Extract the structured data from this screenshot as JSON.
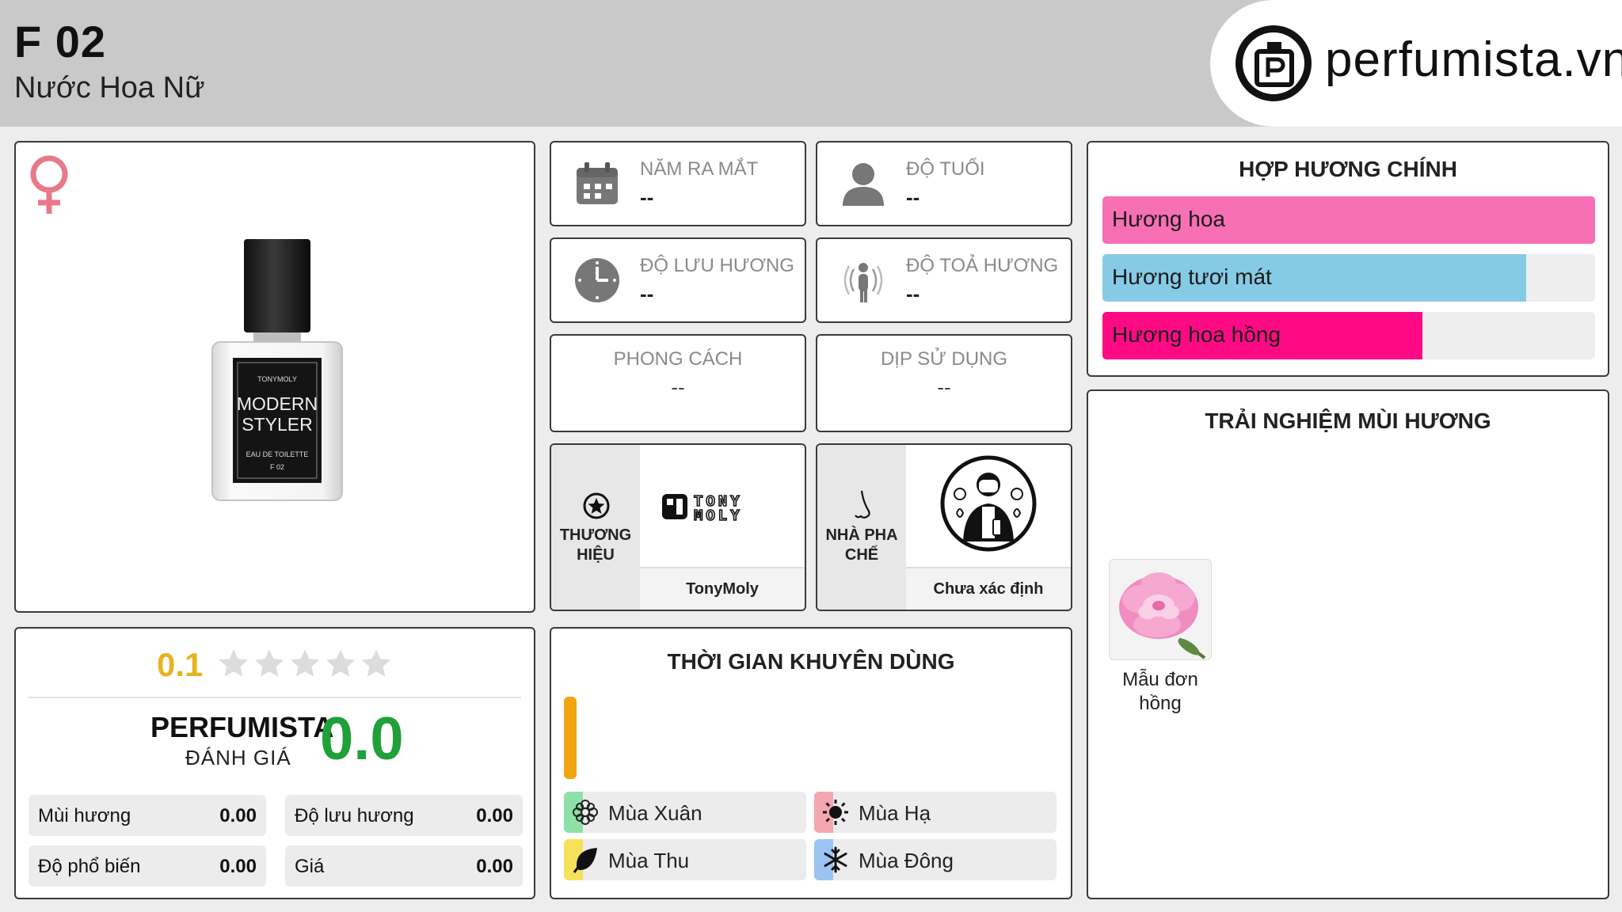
{
  "header": {
    "code": "F 02",
    "subtitle": "Nước Hoa Nữ",
    "logo_text": "perfumista.vn"
  },
  "product": {
    "gender_icon": "venus-icon",
    "bottle_label": {
      "brand": "TONYMOLY",
      "line1": "MODERN",
      "line2": "STYLER",
      "type": "EAU DE TOILETTE",
      "code": "F 02"
    }
  },
  "info": {
    "launch_year": {
      "label": "NĂM RA MẮT",
      "value": "--",
      "icon": "calendar-icon"
    },
    "age": {
      "label": "ĐỘ TUỔI",
      "value": "--",
      "icon": "person-icon"
    },
    "longevity": {
      "label": "ĐỘ LƯU HƯƠNG",
      "value": "--",
      "icon": "clock-icon"
    },
    "sillage": {
      "label": "ĐỘ TOẢ HƯƠNG",
      "value": "--",
      "icon": "diffuse-icon"
    },
    "style": {
      "label": "PHONG CÁCH",
      "value": "--"
    },
    "occasion": {
      "label": "DỊP SỬ DỤNG",
      "value": "--"
    }
  },
  "brand": {
    "label": "THƯƠNG HIỆU",
    "logo_text_1": "TONY",
    "logo_text_2": "MOLY",
    "name": "TonyMoly",
    "icon": "star-badge-icon"
  },
  "perfumer": {
    "label": "NHÀ PHA CHẾ",
    "name": "Chưa xác định",
    "icon": "nose-icon",
    "avatar": "perfumer-avatar-icon"
  },
  "accords": {
    "title": "HỢP HƯƠNG CHÍNH",
    "items": [
      {
        "label": "Hương hoa",
        "level": 1.0,
        "color": "#f76fb4"
      },
      {
        "label": "Hương tươi mát",
        "level": 0.86,
        "color": "#86cbe6"
      },
      {
        "label": "Hương hoa hồng",
        "level": 0.65,
        "color": "#ff0a84"
      }
    ]
  },
  "experience": {
    "title": "TRẢI NGHIỆM MÙI HƯƠNG",
    "notes": [
      {
        "label": "Mẫu đơn hồng",
        "icon": "peony-icon"
      }
    ]
  },
  "rating": {
    "score": "0.1",
    "stars_filled": 0.02,
    "perfumista_title": "PERFUMISTA",
    "perfumista_sub": "ĐÁNH GIÁ",
    "perfumista_score": "0.0",
    "metrics": [
      {
        "label": "Mùi hương",
        "value": "0.00"
      },
      {
        "label": "Độ lưu hương",
        "value": "0.00"
      },
      {
        "label": "Độ phổ biến",
        "value": "0.00"
      },
      {
        "label": "Giá",
        "value": "0.00"
      }
    ]
  },
  "usage": {
    "title": "THỜI GIAN KHUYÊN DÙNG",
    "seasons": [
      {
        "label": "Mùa Xuân",
        "color": "#8ee0a8",
        "icon": "spring-flower-icon"
      },
      {
        "label": "Mùa Hạ",
        "color": "#f6a6b0",
        "icon": "sun-icon"
      },
      {
        "label": "Mùa Thu",
        "color": "#f5e15a",
        "icon": "leaf-icon"
      },
      {
        "label": "Mùa Đông",
        "color": "#9cc4f0",
        "icon": "snowflake-icon"
      }
    ]
  }
}
